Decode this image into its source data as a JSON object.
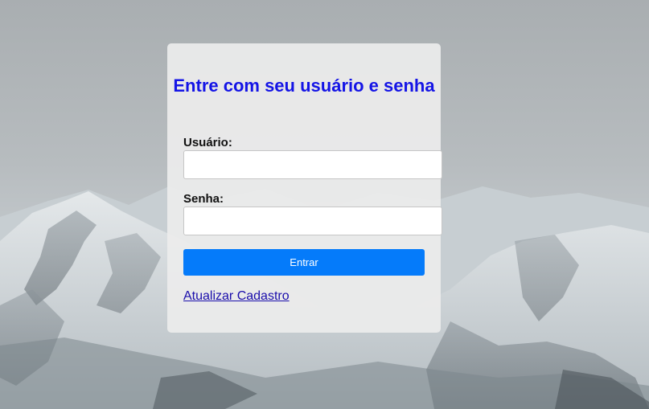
{
  "form": {
    "title": "Entre com seu usuário e senha",
    "username_label": "Usuário:",
    "username_value": "",
    "password_label": "Senha:",
    "password_value": "",
    "submit_label": "Entrar",
    "update_link": "Atualizar Cadastro"
  },
  "colors": {
    "title": "#1414e6",
    "button": "#057bfa",
    "link": "#1a0dab"
  }
}
